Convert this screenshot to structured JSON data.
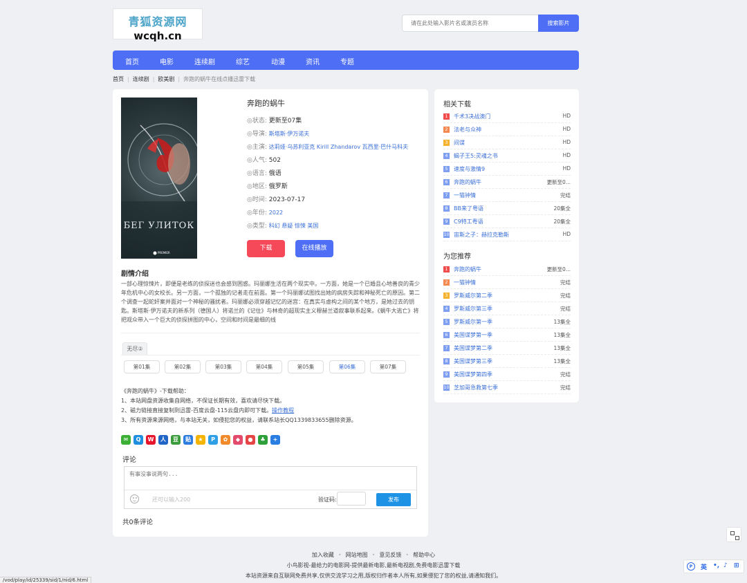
{
  "site": {
    "logo_line1": "青狐资源网",
    "logo_line2": "wcqh.cn"
  },
  "search": {
    "placeholder": "请在此处输入影片名或演员名称",
    "button": "搜索影片"
  },
  "nav": [
    "首页",
    "电影",
    "连续剧",
    "综艺",
    "动漫",
    "资讯",
    "专题"
  ],
  "breadcrumb": {
    "items": [
      "首页",
      "连续剧",
      "欧美剧"
    ],
    "current": "奔跑的蜗牛在线点播迅雷下载"
  },
  "poster": {
    "title_text": "БЕГ УЛИТОК",
    "brand": "PREMIER"
  },
  "movie": {
    "title": "奔跑的蜗牛",
    "fields": [
      {
        "label": "◎状态:",
        "value": "更新至07集"
      },
      {
        "label": "◎导演:",
        "value": "斯塔斯·伊万诺夫"
      },
      {
        "label": "◎主演:",
        "value": "达莉娅·乌苏利亚克 Kirill Zhandarov 瓦西里·巴什马科夫"
      },
      {
        "label": "◎人气:",
        "value": "502"
      },
      {
        "label": "◎语言:",
        "value": "俄语"
      },
      {
        "label": "◎地区:",
        "value": "俄罗斯"
      },
      {
        "label": "◎时间:",
        "value": "2023-07-17"
      },
      {
        "label": "◎年份:",
        "value": "2022"
      },
      {
        "label": "◎类型:",
        "value": "科幻 悬疑 惊悚 美国"
      }
    ],
    "download_button": "下载",
    "play_button": "在线播放"
  },
  "plot": {
    "heading": "剧情介绍",
    "text": "一部心理惊悚片，即便是老练的侦探迷也会感到困惑。玛丽娜生活在两个现实中。一方面，她是一个已婚且心地善良的青少年危机中心的女校长。另一方面，一个孤独的记者走在前面。第一个玛丽娜试图找出她的病房失踪和神秘死亡的原因。第二个调查一起蛇奸案并面对一个神秘的骚扰者。玛丽娜必须穿越记忆的迷宫：在真实与虚构之间的某个地方，是她过去的钥匙。斯塔斯·伊万诺夫的新系列（德国人）将诺兰的《记住》与林奇的超现实主义穆赫兰道叙事联系起来。《蜗牛大逃亡》将把观众带入一个巨大的侦探拼图的中心，空间和时间是最细的线"
  },
  "episodes": {
    "source_tab": "无尽②",
    "items": [
      "第01集",
      "第02集",
      "第03集",
      "第04集",
      "第05集",
      "第06集",
      "第07集"
    ],
    "active_index": 5
  },
  "help": {
    "title": "《奔跑的蜗牛》-下载帮助：",
    "line1": "1、本站网盘资源收集自网络，不保证长期有效，喜欢请尽快下载。",
    "line2": "2、磁力链接直接复制到迅雷-百度云盘-115云盘内即可下载。",
    "line2_link": "操作教程",
    "line3": "3、所有资源来源网络，与本站无关，如侵犯您的权益，请联系站长QQ1339833655删除资源。"
  },
  "share_icons": [
    "wechat-icon",
    "qq-icon",
    "weibo-icon",
    "renren-icon",
    "douban-icon",
    "tieba-icon",
    "qzone-icon",
    "pengyou-icon",
    "kaixin-icon",
    "bookmark-icon",
    "netease-icon",
    "clover-icon",
    "more-icon"
  ],
  "comment": {
    "heading": "评论",
    "placeholder": "有事没事说两句...",
    "remain": "还可以输入200",
    "verify_label": "验证码:",
    "submit": "发布",
    "count": "共0条评论"
  },
  "related": {
    "heading": "相关下载",
    "items": [
      {
        "num": "1",
        "title": "千术3决战澳门",
        "status": "HD"
      },
      {
        "num": "2",
        "title": "法老与众神",
        "status": "HD"
      },
      {
        "num": "3",
        "title": "间谍",
        "status": "HD"
      },
      {
        "num": "4",
        "title": "蝎子王5:灵魂之书",
        "status": "HD"
      },
      {
        "num": "5",
        "title": "速度与激情9",
        "status": "HD"
      },
      {
        "num": "6",
        "title": "奔跑的蜗牛",
        "status": "更新至0..."
      },
      {
        "num": "7",
        "title": "一猫钟情",
        "status": "完结"
      },
      {
        "num": "8",
        "title": "BB来了粤语",
        "status": "20集全"
      },
      {
        "num": "9",
        "title": "C9特工粤语",
        "status": "20集全"
      },
      {
        "num": "10",
        "title": "宙斯之子：赫拉克勒斯",
        "status": "HD"
      }
    ]
  },
  "recommend": {
    "heading": "为您推荐",
    "items": [
      {
        "num": "1",
        "title": "奔跑的蜗牛",
        "status": "更新至0..."
      },
      {
        "num": "2",
        "title": "一猫钟情",
        "status": "完结"
      },
      {
        "num": "3",
        "title": "罗斯威尔第二季",
        "status": "完结"
      },
      {
        "num": "4",
        "title": "罗斯威尔第三季",
        "status": "完结"
      },
      {
        "num": "5",
        "title": "罗斯威尔第一季",
        "status": "13集全"
      },
      {
        "num": "6",
        "title": "美国谍梦第一季",
        "status": "13集全"
      },
      {
        "num": "7",
        "title": "美国谍梦第二季",
        "status": "13集全"
      },
      {
        "num": "8",
        "title": "美国谍梦第三季",
        "status": "13集全"
      },
      {
        "num": "9",
        "title": "美国谍梦第四季",
        "status": "完结"
      },
      {
        "num": "10",
        "title": "芝加哥急救第七季",
        "status": "完结"
      }
    ]
  },
  "rank_colors": {
    "1": "#f24d4d",
    "2": "#f5884f",
    "3": "#f5b22e",
    "other": "#7e9ef2"
  },
  "footer": {
    "links": [
      "加入收藏",
      "网站地图",
      "意见反馈",
      "帮助中心"
    ],
    "line2": "小鸟影视-最给力的电影网-提供最新电影,最新电视剧,免费电影迅雷下载",
    "line3": "本站资源来自互联网免费共享,仅供交流学习之用,版权归作者本人所有,如果侵犯了您的权益,请通知我们。"
  },
  "ime": {
    "lang": "英"
  },
  "status_url": "/vod/play/id/25339/sid/1/nid/6.html"
}
